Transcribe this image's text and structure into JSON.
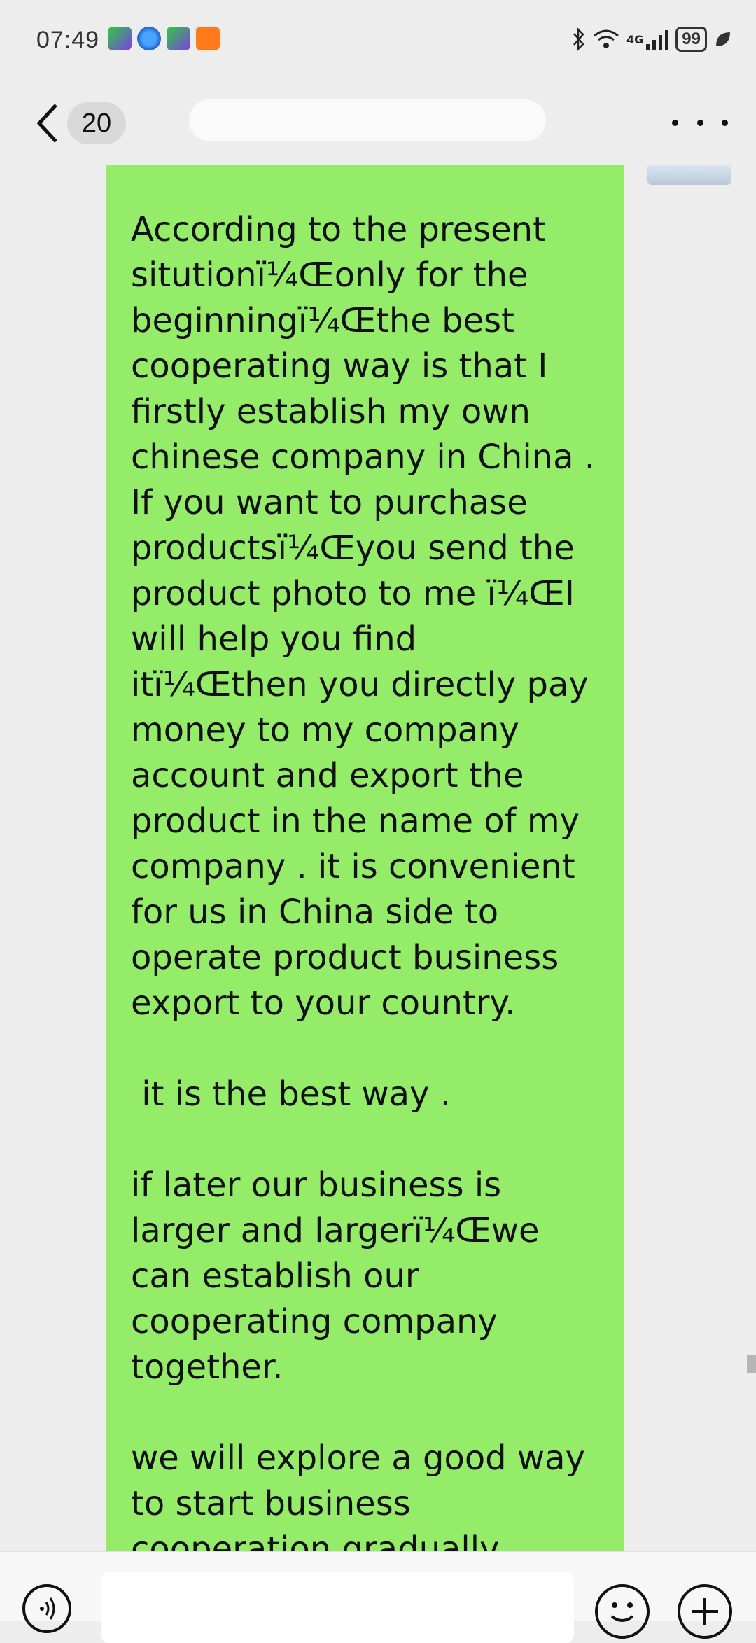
{
  "status_bar": {
    "time": "07:49",
    "app_icons": [
      "iqiyi-icon",
      "browser-icon",
      "iqiyi-icon",
      "video-player-icon"
    ],
    "right_icons": [
      "bluetooth-icon",
      "wifi-icon",
      "4g-signal-icon"
    ],
    "network": "4G",
    "battery": "99"
  },
  "header": {
    "unread_count": "20",
    "contact_name": ""
  },
  "message": {
    "paragraphs": [
      "According to the present situtionï¼Œonly for the beginningï¼Œthe best cooperating way is that I firstly establish my own chinese company in China . If you want to purchase productsï¼Œyou send the product photo to me ï¼ŒI will help you find itï¼Œthen you directly pay money to my company account and export the product in the name of my company . it is convenient for us in China side to operate product business export to your country.",
      " it is the best way .",
      "if later our business is larger and largerï¼Œwe can establish our cooperating company together.",
      "we will explore a good way to start business cooperation gradually."
    ]
  },
  "colors": {
    "bubble": "#95ec69",
    "background": "#ededed",
    "text": "#111111"
  }
}
